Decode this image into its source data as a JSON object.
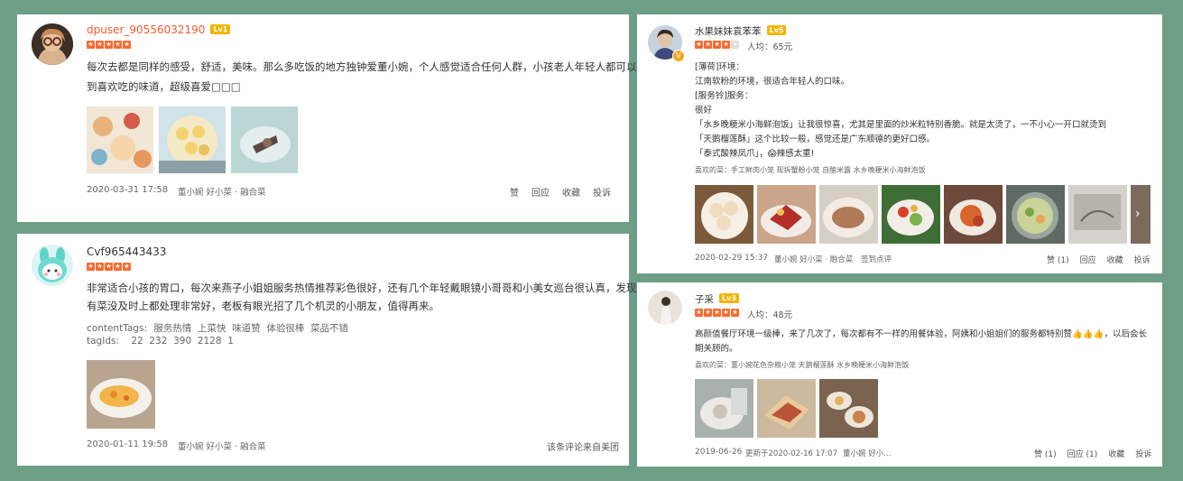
{
  "reviews": [
    {
      "username": "dpuser_90556032190",
      "level": "Lv1",
      "text_lines": [
        "每次去都是同样的感受，舒适，美味。那么多吃饭的地方独钟爱董小婉，个人感觉适合任何人群，小孩老人年轻人都可以找",
        "到喜欢吃的味道，超级喜爱□□□"
      ],
      "date": "2020-03-31 17:58",
      "shop": "董小婉 好小菜 · 融合菜",
      "actions": [
        "赞",
        "回应",
        "收藏",
        "投诉"
      ]
    },
    {
      "username": "Cvf965443433",
      "text_lines": [
        "非常适合小孩的胃口，每次来燕子小姐姐服务热情推荐彩色很好，还有几个年轻戴眼镜小哥哥和小美女巡台很认真，发现",
        "有菜没及时上都处理非常好，老板有眼光招了几个机灵的小朋友，值得再来。"
      ],
      "content_tags_label": "contentTags:",
      "content_tags": "服务热情  上菜快  味道赞  体验很棒  菜品不错",
      "tag_ids_label": "tagIds:",
      "tag_ids": "22  232  390  2128  1",
      "date": "2020-01-11 19:58",
      "shop": "董小婉 好小菜 · 融合菜",
      "source": "该条评论来自美团"
    },
    {
      "username": "水果妹妹袁苯苯",
      "level": "Lv5",
      "avg_price": "人均：65元",
      "text_lines": [
        "[薄荷]环境：",
        "江南软粉的环境，很适合年轻人的口味。",
        "[服务铃]服务：",
        "很好",
        "「水乡晚粳米小海鲜泡饭」让我很惊喜，尤其是里面的炒米粒特别香脆。就是太烫了，一不小心一开口就烫到",
        "「天鹅榴莲酥」这个比较一般，感觉还是广东顺德的更好口感。",
        "「泰式酸辣凤爪」，😱辣感太重!"
      ],
      "favorite_dishes": "喜欢的菜：手工鲜肉小笼  现拆蟹粉小笼  自酿米露  水乡晚粳米小海鲜泡饭",
      "date": "2020-02-29 15:37",
      "shop": "董小婉 好小菜 · 融合菜",
      "sign": "签到点评",
      "actions": [
        "赞 (1)",
        "回应",
        "收藏",
        "投诉"
      ]
    },
    {
      "username": "子采",
      "level": "Lv3",
      "avg_price": "人均：48元",
      "text_lines": [
        "高颜值餐厅环境一级棒，来了几次了，每次都有不一样的用餐体验，阿姨和小姐姐们的服务都特别赞👍👍👍，以后会长",
        "期关顾的。"
      ],
      "favorite_dishes": "喜欢的菜：董小婉花色杂粮小笼  天鹅榴莲酥  水乡晚粳米小海鲜泡饭",
      "date": "2019-06-26",
      "updated": "更新于2020-02-16 17:07",
      "shop": "董小婉 好小...",
      "actions": [
        "赞 (1)",
        "回应 (1)",
        "收藏",
        "投诉"
      ]
    }
  ],
  "colors": {
    "background": "#6f9e86",
    "star": "#f96b2f",
    "level_badge": "#f5b300",
    "username_highlight": "#f25c2c"
  },
  "icons": {
    "star": "star-icon",
    "verified": "verified-badge-icon",
    "next": "chevron-right-icon"
  }
}
